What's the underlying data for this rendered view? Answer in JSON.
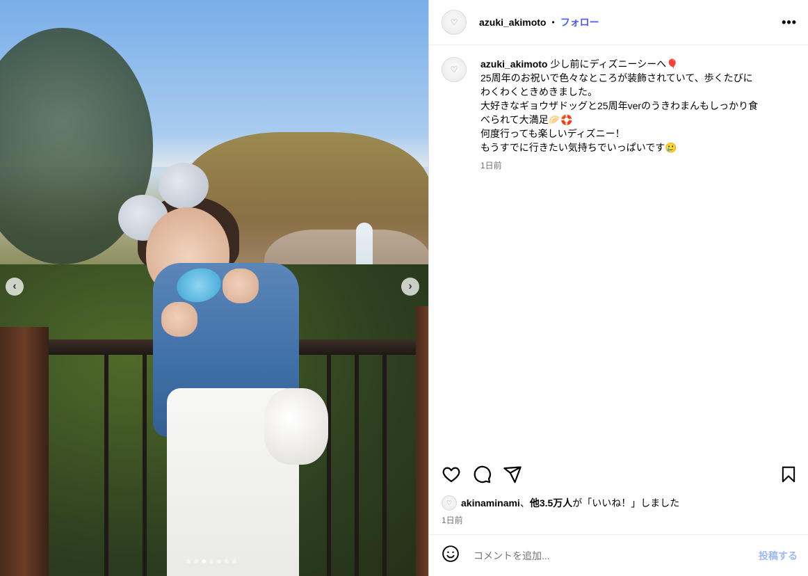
{
  "post": {
    "username": "azuki_akimoto",
    "separator": "•",
    "follow_label": "フォロー",
    "more_label": "•••",
    "caption_lines": [
      "少し前にディズニーシーへ🎈",
      "25周年のお祝いで色々なところが装飾されていて、歩くたびに",
      "わくわくときめきました。",
      "大好きなギョウザドッグと25周年verのうきわまんもしっかり食",
      "べられて大満足🥟🛟",
      "何度行っても楽しいディズニー！",
      "もうすでに行きたい気持ちでいっぱいです🥲"
    ],
    "caption_time": "1日前"
  },
  "carousel": {
    "prev_label": "‹",
    "next_label": "›",
    "dot_count": 7,
    "active_dot": 3
  },
  "likes": {
    "liker": "akinaminami",
    "middle": "、",
    "others": "他3.5万人",
    "suffix": "が「いいね！」しました"
  },
  "time": "1日前",
  "comment": {
    "placeholder": "コメントを追加...",
    "post_label": "投稿する"
  },
  "icons": {
    "like": "heart-icon",
    "comment": "comment-icon",
    "share": "send-icon",
    "save": "bookmark-icon",
    "emoji": "emoji-icon"
  },
  "colors": {
    "accent": "#4a5bf1",
    "post_disabled": "#9fb8f5",
    "muted": "#737373"
  }
}
